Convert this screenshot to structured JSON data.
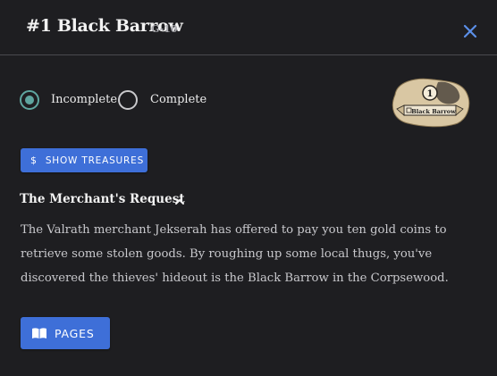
{
  "header": {
    "title": "#1 Black Barrow",
    "coord": "G-10"
  },
  "status": {
    "options": [
      {
        "label": "Incomplete",
        "selected": true
      },
      {
        "label": "Complete",
        "selected": false
      }
    ]
  },
  "map": {
    "number": "1",
    "label": "Black Barrow"
  },
  "buttons": {
    "treasures_label": "SHOW TREASURES",
    "pages_label": "PAGES"
  },
  "section": {
    "title": "The Merchant's Request",
    "body": "The Valrath merchant Jekserah has offered to pay you ten gold coins to retrieve some stolen goods. By roughing up some local thugs, you've discovered the thieves' hideout is the Black Barrow in the Corpsewood."
  },
  "colors": {
    "background": "#1e1e21",
    "accent_blue": "#3e6fd8",
    "radio_selected": "#5fa6a0",
    "close_icon": "#5b8fe8"
  },
  "icons": [
    "close-icon",
    "dollar-icon",
    "chevron-up-icon",
    "book-icon"
  ]
}
